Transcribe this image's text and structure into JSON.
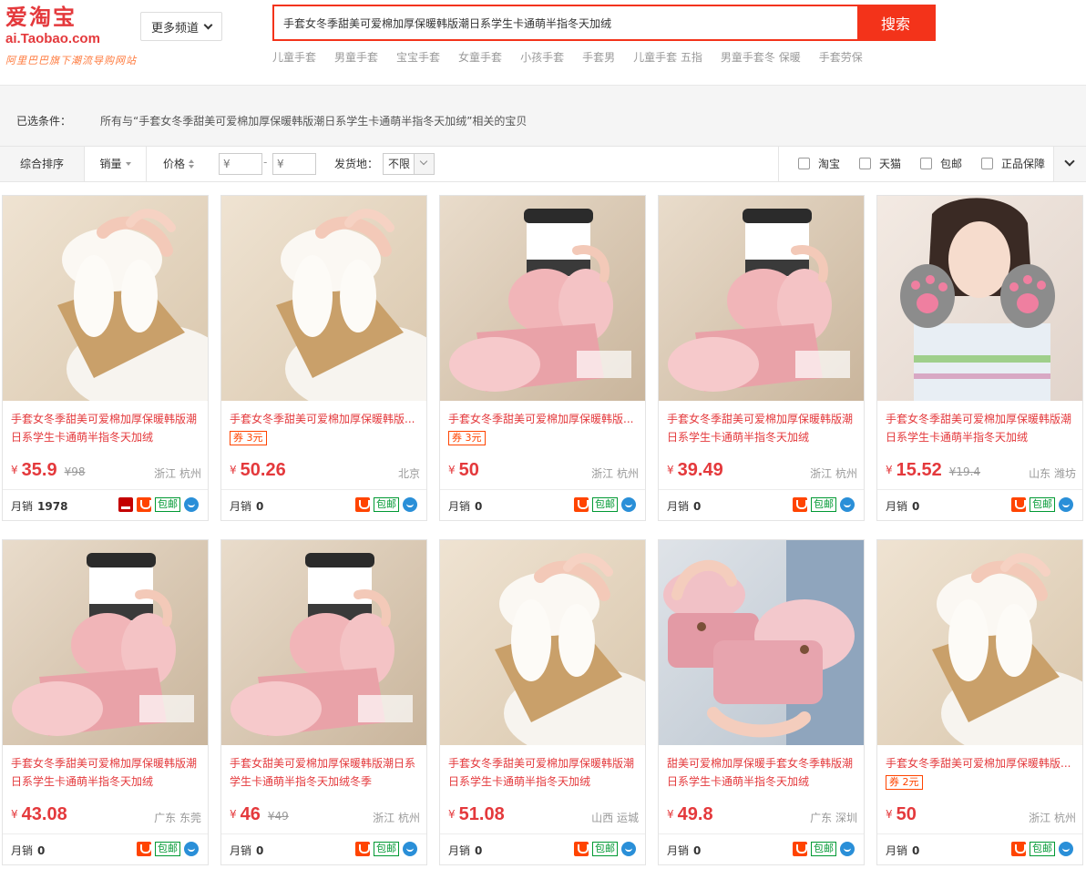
{
  "header": {
    "logo_cn": "爱淘宝",
    "logo_domain": "ai.Taobao.com",
    "logo_slogan": "阿里巴巴旗下潮流导购网站",
    "channels_label": "更多频道",
    "search_value": "手套女冬季甜美可爱棉加厚保暖韩版潮日系学生卡通萌半指冬天加绒",
    "search_button": "搜索",
    "hot_words": [
      "儿童手套",
      "男童手套",
      "宝宝手套",
      "女童手套",
      "小孩手套",
      "手套男",
      "儿童手套 五指",
      "男童手套冬 保暖",
      "手套劳保"
    ]
  },
  "filters": {
    "selected_label": "已选条件：",
    "selected_text": "所有与“手套女冬季甜美可爱棉加厚保暖韩版潮日系学生卡通萌半指冬天加绒”相关的宝贝",
    "sort_default": "综合排序",
    "sort_sales": "销量",
    "sort_price": "价格",
    "price_min_placeholder": "¥",
    "price_max_placeholder": "¥",
    "price_dash": "-",
    "ship_label": "发货地：",
    "ship_value": "不限",
    "checks": [
      "淘宝",
      "天猫",
      "包邮",
      "正品保障"
    ]
  },
  "labels": {
    "yen": "¥",
    "monthly_sales": "月销",
    "baoyou": "包邮"
  },
  "colors": {
    "brand_red": "#f3331a",
    "price_red": "#e4393c",
    "baoyou_green": "#009933",
    "wangwang_blue": "#2a8fd8"
  },
  "products": [
    {
      "title": "手套女冬季甜美可爱棉加厚保暖韩版潮日系学生卡通萌半指冬天加绒",
      "coupon": "",
      "price": "35.9",
      "old_price": "98",
      "location": "浙江 杭州",
      "sales": "1978",
      "tmall": true,
      "img": "beige"
    },
    {
      "title": "手套女冬季甜美可爱棉加厚保暖韩版...",
      "coupon": "券 3元",
      "price": "50.26",
      "old_price": "",
      "location": "北京",
      "sales": "0",
      "tmall": false,
      "img": "beige"
    },
    {
      "title": "手套女冬季甜美可爱棉加厚保暖韩版...",
      "coupon": "券 3元",
      "price": "50",
      "old_price": "",
      "location": "浙江 杭州",
      "sales": "0",
      "tmall": false,
      "img": "pink-cup"
    },
    {
      "title": "手套女冬季甜美可爱棉加厚保暖韩版潮日系学生卡通萌半指冬天加绒",
      "coupon": "",
      "price": "39.49",
      "old_price": "",
      "location": "浙江 杭州",
      "sales": "0",
      "tmall": false,
      "img": "pink-cup"
    },
    {
      "title": "手套女冬季甜美可爱棉加厚保暖韩版潮日系学生卡通萌半指冬天加绒",
      "coupon": "",
      "price": "15.52",
      "old_price": "19.4",
      "location": "山东 潍坊",
      "sales": "0",
      "tmall": false,
      "img": "paw"
    },
    {
      "title": "手套女冬季甜美可爱棉加厚保暖韩版潮日系学生卡通萌半指冬天加绒",
      "coupon": "",
      "price": "43.08",
      "old_price": "",
      "location": "广东 东莞",
      "sales": "0",
      "tmall": false,
      "img": "pink-cup"
    },
    {
      "title": "手套女甜美可爱棉加厚保暖韩版潮日系学生卡通萌半指冬天加绒冬季",
      "coupon": "",
      "price": "46",
      "old_price": "49",
      "location": "浙江 杭州",
      "sales": "0",
      "tmall": false,
      "img": "pink-cup"
    },
    {
      "title": "手套女冬季甜美可爱棉加厚保暖韩版潮日系学生卡通萌半指冬天加绒",
      "coupon": "",
      "price": "51.08",
      "old_price": "",
      "location": "山西 运城",
      "sales": "0",
      "tmall": false,
      "img": "beige"
    },
    {
      "title": "甜美可爱棉加厚保暖手套女冬季韩版潮日系学生卡通萌半指冬天加绒",
      "coupon": "",
      "price": "49.8",
      "old_price": "",
      "location": "广东 深圳",
      "sales": "0",
      "tmall": false,
      "img": "pink-gray"
    },
    {
      "title": "手套女冬季甜美可爱棉加厚保暖韩版...",
      "coupon": "券 2元",
      "price": "50",
      "old_price": "",
      "location": "浙江 杭州",
      "sales": "0",
      "tmall": false,
      "img": "beige"
    }
  ]
}
